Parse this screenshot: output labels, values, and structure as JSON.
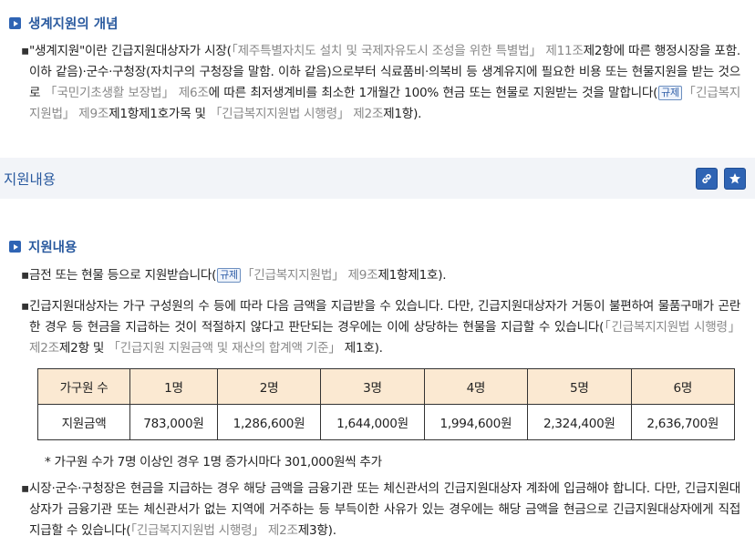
{
  "section1": {
    "title": "생계지원의 개념",
    "para": {
      "t1": "\"생계지원\"이란 긴급지원대상자가 시장(",
      "law1": "「제주특별자치도 설치 및 국제자유도시 조성을 위한 특별법」 제11조",
      "t2": "제2항에 따른 행정시장을 포함. 이하 같음)·군수·구청장(자치구의 구청장을 말함. 이하 같음)으로부터 식료품비·의복비 등 생계유지에 필요한 비용 또는 현물지원을 받는 것으로 ",
      "law2": "「국민기초생활 보장법」 제6조",
      "t3": "에 따른 최저생계비를 최소한 1개월간 100% 현금 또는 현물로 지원받는 것을 말합니다(",
      "tag": "규제",
      "law3": "「긴급복지지원법」 제9조",
      "t4": "제1항제1호가목 및 ",
      "law4": "「긴급복지지원법 시행령」 제2조",
      "t5": "제1항)."
    }
  },
  "band": {
    "title": "지원내용",
    "link_icon": "link-icon",
    "star_icon": "star-icon"
  },
  "section2": {
    "title": "지원내용",
    "p1": {
      "t1": "금전 또는 현물 등으로 지원받습니다(",
      "tag": "규제",
      "law1": "「긴급복지지원법」 제9조",
      "t2": "제1항제1호)."
    },
    "p2": {
      "t1": "긴급지원대상자는 가구 구성원의 수 등에 따라 다음 금액을 지급받을 수 있습니다. 다만, 긴급지원대상자가 거동이 불편하여 물품구매가 곤란한 경우 등 현금을 지급하는 것이 적절하지 않다고 판단되는 경우에는 이에 상당하는 현물을 지급할 수 있습니다(",
      "law1": "「긴급복지지원법 시행령」 제2조",
      "t2": "제2항 및 ",
      "law2": "「긴급지원 지원금액 및 재산의 합계액 기준」",
      "t3": " 제1호)."
    },
    "table": {
      "header": [
        "가구원 수",
        "1명",
        "2명",
        "3명",
        "4명",
        "5명",
        "6명"
      ],
      "row": [
        "지원금액",
        "783,000원",
        "1,286,600원",
        "1,644,000원",
        "1,994,600원",
        "2,324,400원",
        "2,636,700원"
      ]
    },
    "note": "* 가구원 수가 7명 이상인 경우 1명 증가시마다 301,000원씩 추가",
    "p3": {
      "t1": "시장·군수·구청장은 현금을 지급하는 경우 해당 금액을 금융기관 또는 체신관서의 긴급지원대상자 계좌에 입금해야 합니다. 다만, 긴급지원대상자가 금융기관 또는 체신관서가 없는 지역에 거주하는 등 부득이한 사유가 있는 경우에는 해당 금액을 현금으로 긴급지원대상자에게 직접 지급할 수 있습니다(",
      "law1": "「긴급복지지원법 시행령」 제2조",
      "t2": "제3항)."
    }
  },
  "colors": {
    "accent": "#2f64b4",
    "title": "#2a5a9f",
    "law_text": "#888888",
    "table_header_bg": "#fbe9d2",
    "band_bg": "#f2f4f8"
  }
}
